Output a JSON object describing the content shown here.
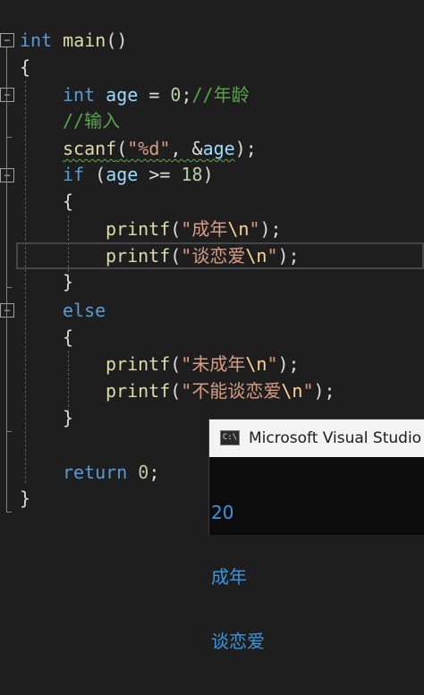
{
  "editor": {
    "lines": {
      "l1": {
        "kw": "int",
        "fn": "main",
        "rest": "()"
      },
      "l2": {
        "text": "{"
      },
      "l3": {
        "kw": "int",
        "id": "age",
        "op": " = ",
        "num": "0",
        "semi": ";",
        "comment": "//年龄"
      },
      "l4": {
        "comment": "//输入"
      },
      "l5": {
        "fn": "scanf",
        "open": "(",
        "str": "\"%d\"",
        "comma": ", &",
        "id": "age",
        "close": ");"
      },
      "l6": {
        "kw": "if",
        "open": " (",
        "id": "age",
        "op": " >= ",
        "num": "18",
        "close": ")"
      },
      "l7": {
        "text": "{"
      },
      "l8": {
        "fn": "printf",
        "open": "(",
        "str": "\"成年",
        "esc": "\\n",
        "strend": "\"",
        "close": ");"
      },
      "l9": {
        "fn": "printf",
        "open": "(",
        "str": "\"谈恋爱",
        "esc": "\\n",
        "strend": "\"",
        "close": ");"
      },
      "l10": {
        "text": "}"
      },
      "l11": {
        "kw": "else"
      },
      "l12": {
        "text": "{"
      },
      "l13": {
        "fn": "printf",
        "open": "(",
        "str": "\"未成年",
        "esc": "\\n",
        "strend": "\"",
        "close": ");"
      },
      "l14": {
        "fn": "printf",
        "open": "(",
        "str": "\"不能谈恋爱",
        "esc": "\\n",
        "strend": "\"",
        "close": ");"
      },
      "l15": {
        "text": "}"
      },
      "l16": {
        "kw": "return",
        "num": " 0",
        "semi": ";"
      },
      "l17": {
        "text": "}"
      }
    },
    "fold_glyph": "−"
  },
  "console": {
    "icon_label": "C:\\",
    "title": "Microsoft Visual Studio 调",
    "output": [
      "20",
      "成年",
      "谈恋爱"
    ]
  },
  "colors": {
    "background": "#1e1e1e",
    "keyword": "#569cd6",
    "function": "#dcdcaa",
    "identifier": "#9cdcfe",
    "number": "#b5cea8",
    "string": "#d69d85",
    "comment": "#57a64a",
    "console_text": "#3a96dd"
  }
}
